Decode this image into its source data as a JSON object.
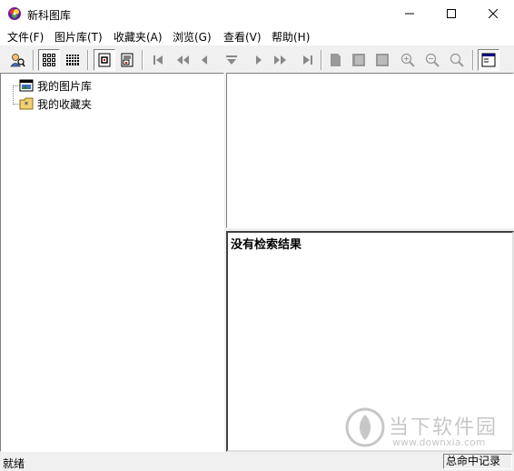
{
  "window": {
    "title": "新科图库"
  },
  "menu": [
    "文件(F)",
    "图片库(T)",
    "收藏夹(A)",
    "浏览(G)",
    "查看(V)",
    "帮助(H)"
  ],
  "toolbar": {
    "buttons": [
      "search-people-icon",
      "large-icons-view-icon",
      "details-view-icon",
      "page-icon",
      "print-preview-icon",
      "first-icon",
      "prev-page-icon",
      "prev-icon",
      "down-icon",
      "next-icon",
      "next-page-icon",
      "last-icon",
      "doc-icon",
      "doc-frame-icon",
      "doc-frame2-icon",
      "zoom-in-icon",
      "zoom-out-icon",
      "zoom-icon",
      "window-icon"
    ]
  },
  "tree": {
    "items": [
      {
        "label": "我的图片库",
        "icon": "image-library-icon"
      },
      {
        "label": "我的收藏夹",
        "icon": "favorites-icon"
      }
    ]
  },
  "results": {
    "empty_text": "没有检索结果"
  },
  "status": {
    "left": "就绪",
    "right": "总命中记录"
  },
  "watermark": {
    "brand": "当下软件园",
    "url": "www.downxia.com"
  }
}
